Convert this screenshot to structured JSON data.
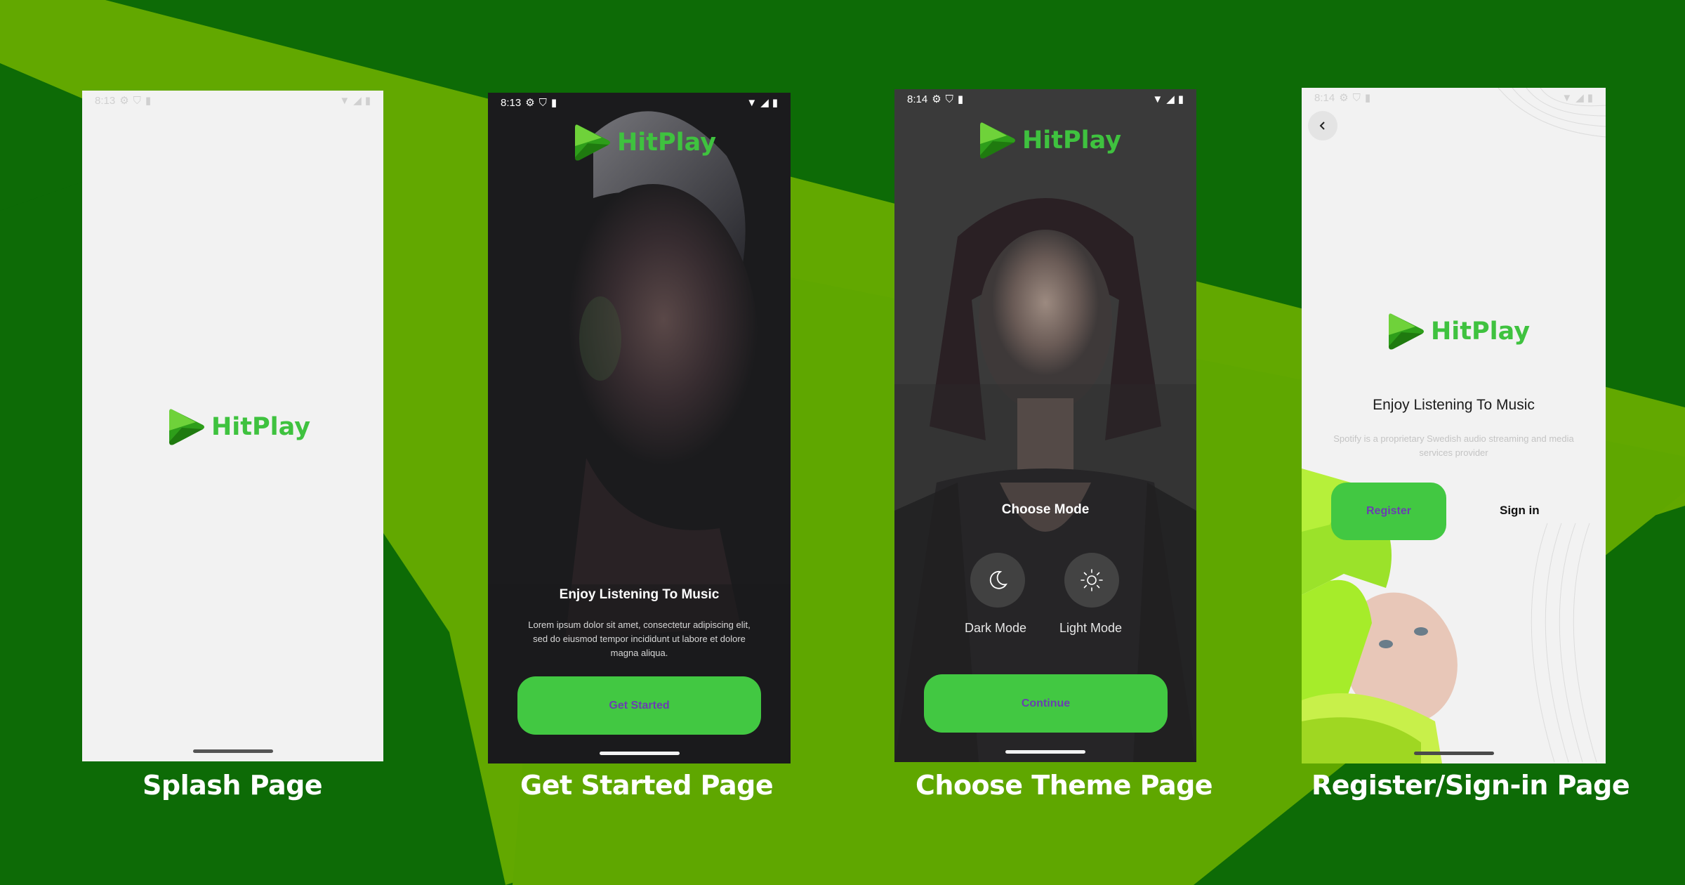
{
  "brand": {
    "app_name": "HitPlay",
    "logo_color": "#3fc23f",
    "accent_button": "#42c842",
    "button_text_color": "#6a3fb0"
  },
  "background": {
    "dark_green": "#0d6b06",
    "light_green": "#62a800"
  },
  "screens": {
    "splash": {
      "status_time": "8:13",
      "caption": "Splash Page"
    },
    "get_started": {
      "status_time": "8:13",
      "heading": "Enjoy Listening To Music",
      "body": "Lorem ipsum dolor sit amet, consectetur adipiscing elit, sed do eiusmod tempor incididunt ut labore et dolore magna aliqua.",
      "button": "Get Started",
      "caption": "Get Started Page"
    },
    "choose_theme": {
      "status_time": "8:14",
      "heading": "Choose Mode",
      "dark_mode_label": "Dark Mode",
      "light_mode_label": "Light Mode",
      "button": "Continue",
      "caption": "Choose Theme Page"
    },
    "register": {
      "status_time": "8:14",
      "heading": "Enjoy Listening To Music",
      "body": "Spotify is a proprietary Swedish audio streaming and media services provider",
      "register_button": "Register",
      "signin_link": "Sign in",
      "caption": "Register/Sign-in Page"
    }
  }
}
